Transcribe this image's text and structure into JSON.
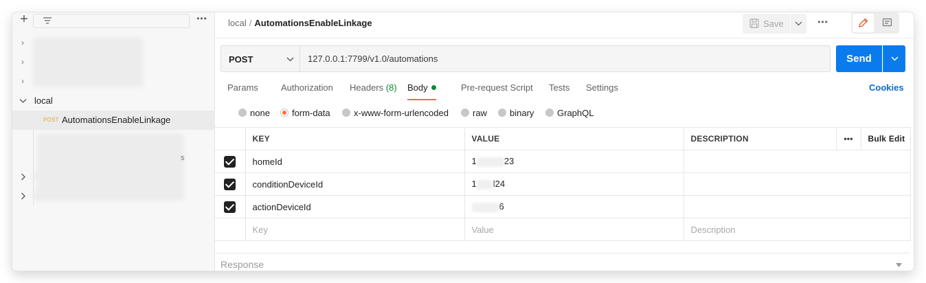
{
  "sidebar": {
    "new_label": "+",
    "more_label": "•••",
    "collection": {
      "name": "local"
    },
    "request": {
      "method": "POST",
      "name": "AutomationsEnableLinkage"
    },
    "hidden_fragment": "s",
    "collapsed_rows": [
      "",
      ""
    ]
  },
  "header": {
    "breadcrumb_parent": "local",
    "breadcrumb_sep": "/",
    "breadcrumb_current": "AutomationsEnableLinkage",
    "save_label": "Save",
    "more_label": "•••"
  },
  "request": {
    "method": "POST",
    "url": "127.0.0.1:7799/v1.0/automations",
    "send_label": "Send"
  },
  "tabs": {
    "params": "Params",
    "authorization": "Authorization",
    "headers": "Headers",
    "headers_count": "(8)",
    "body": "Body",
    "prerequest": "Pre-request Script",
    "tests": "Tests",
    "settings": "Settings",
    "cookies": "Cookies"
  },
  "body_types": {
    "none": "none",
    "form_data": "form-data",
    "urlencoded": "x-www-form-urlencoded",
    "raw": "raw",
    "binary": "binary",
    "graphql": "GraphQL",
    "selected": "form-data"
  },
  "params_table": {
    "headers": {
      "key": "KEY",
      "value": "VALUE",
      "description": "DESCRIPTION",
      "more": "•••",
      "bulk_edit": "Bulk Edit"
    },
    "rows": [
      {
        "checked": true,
        "key": "homeId",
        "value_prefix": "1",
        "value_suffix": "23",
        "description": ""
      },
      {
        "checked": true,
        "key": "conditionDeviceId",
        "value_prefix": "1",
        "value_suffix": "l24",
        "description": ""
      },
      {
        "checked": true,
        "key": "actionDeviceId",
        "value_prefix": "",
        "value_suffix": "6",
        "description": ""
      }
    ],
    "placeholders": {
      "key": "Key",
      "value": "Value",
      "description": "Description"
    }
  },
  "response": {
    "label": "Response"
  },
  "colors": {
    "accent_orange": "#ff6c37",
    "send_blue": "#097bed",
    "link_blue": "#0b6ad1",
    "status_green": "#0b8a2e",
    "method_post_yellow": "#e8a32e"
  }
}
